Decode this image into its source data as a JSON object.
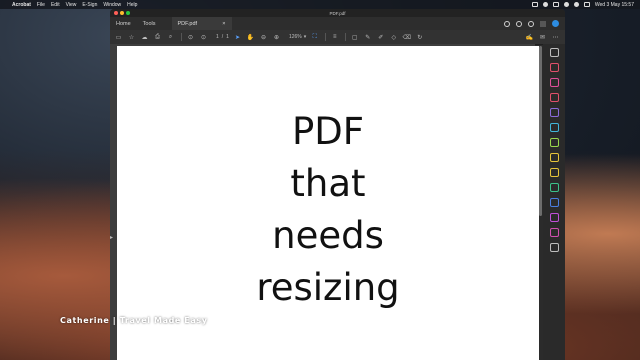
{
  "menubar": {
    "app_name": "Acrobat",
    "items": [
      "File",
      "Edit",
      "View",
      "E-Sign",
      "Window",
      "Help"
    ],
    "clock": "Wed 3 May  15:57"
  },
  "window": {
    "title": "PDF.pdf",
    "nav": {
      "home": "Home",
      "tools": "Tools"
    },
    "doc_tab": {
      "label": "PDF.pdf",
      "close": "×"
    }
  },
  "toolbar": {
    "page_current": "1",
    "page_sep": "/",
    "page_total": "1",
    "zoom": "126%",
    "accent_color": "#5aa2ff"
  },
  "document": {
    "lines": [
      "PDF",
      "that",
      "needs",
      "resizing"
    ]
  },
  "right_tools": [
    {
      "icon": "search-zoom-icon",
      "color": "#bdbdbd"
    },
    {
      "icon": "export-pdf-icon",
      "color": "#e0506b"
    },
    {
      "icon": "edit-pdf-icon",
      "color": "#e04f9a"
    },
    {
      "icon": "create-pdf-icon",
      "color": "#e0506b"
    },
    {
      "icon": "fill-sign-icon",
      "color": "#8a6bdc"
    },
    {
      "icon": "organize-pages-icon",
      "color": "#41b7d9"
    },
    {
      "icon": "combine-files-icon",
      "color": "#9ad84c"
    },
    {
      "icon": "scan-ocr-icon",
      "color": "#e7c43a"
    },
    {
      "icon": "comment-icon",
      "color": "#e7c43a"
    },
    {
      "icon": "print-production-icon",
      "color": "#3cc18a"
    },
    {
      "icon": "protect-icon",
      "color": "#4a7de0"
    },
    {
      "icon": "request-signatures-icon",
      "color": "#c04fd9"
    },
    {
      "icon": "compress-icon",
      "color": "#d04fb0"
    },
    {
      "icon": "more-tools-icon",
      "color": "#bdbdbd"
    }
  ],
  "watermark": "Catherine | Travel Made Easy"
}
